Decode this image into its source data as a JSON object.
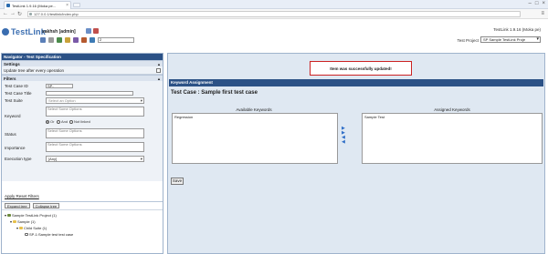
{
  "browser": {
    "tab_title": "TestLink 1.9.16 (Moka pe...",
    "url": "127.0.0.1/testlink/index.php"
  },
  "header": {
    "logo_text": "TestLink",
    "user": "sakhsh [admin]",
    "version": "TestLink 1.9.16 (Moka pe)",
    "test_project_label": "Test Project",
    "test_project_value": "SP Sample TestLink Proje",
    "tc_search_value": "2"
  },
  "left": {
    "navigator_title": "Navigator - Test Specification",
    "settings_title": "Settings",
    "update_tree_label": "Update tree after every operation",
    "filters_title": "Filters",
    "filters": {
      "test_case_id_label": "Test Case ID",
      "test_case_id_value": "SP-",
      "test_case_title_label": "Test Case Title",
      "test_suite_label": "Test Suite",
      "test_suite_placeholder": "Select an Option",
      "keyword_label": "Keyword",
      "keyword_placeholder": "Select Some Options",
      "radio_or": "Or",
      "radio_and": "And",
      "radio_not_linked": "Not linked",
      "status_label": "Status",
      "status_placeholder": "Select Some Options",
      "importance_label": "Importance",
      "importance_placeholder": "Select Some Options",
      "execution_type_label": "Execution type",
      "execution_type_value": "[Any]"
    },
    "apply_reset_label": "Apply Reset Filters",
    "expand_tree": "Expand tree",
    "collapse_tree": "Collapse tree",
    "tree": [
      "Sample TestLink Project (1)",
      "Sample (1)",
      "Child Suite (1)",
      "SP-1:Sample test test case"
    ]
  },
  "right": {
    "success_message": "Item was successfully updated!",
    "section_title": "Keyword Assignment",
    "test_case_title": "Test Case : Sample first test case",
    "available_header": "Available Keywords",
    "assigned_header": "Assigned Keywords",
    "available_items": [
      "Regression"
    ],
    "assigned_items": [
      "Sample Test"
    ],
    "save_label": "Save"
  },
  "colors": {
    "nav_bar": "#2b5186",
    "panel_bg": "#dfe8f2",
    "success_border": "#cc2222"
  }
}
